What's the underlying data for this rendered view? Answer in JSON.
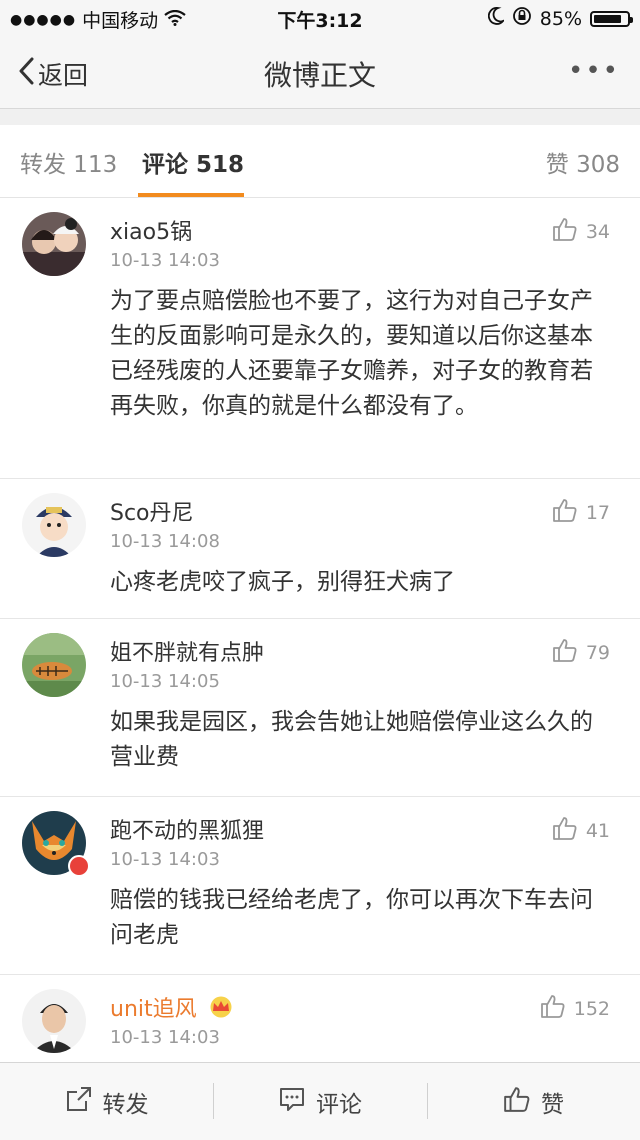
{
  "status_bar": {
    "signal_dots": "●●●●●",
    "carrier": "中国移动",
    "time": "下午3:12",
    "battery_pct": "85%",
    "battery_level": 0.85
  },
  "nav": {
    "back_label": "返回",
    "title": "微博正文",
    "more_label": "•••"
  },
  "tabs": {
    "repost": "转发 113",
    "comments": "评论 518",
    "likes": "赞 308"
  },
  "comments": [
    {
      "user": "xiao5锅",
      "time": "10-13 14:03",
      "likes": "34",
      "text": "为了要点赔偿脸也不要了，这行为对自己子女产生的反面影响可是永久的，要知道以后你这基本已经残废的人还要靠子女赡养，对子女的教育若再失败，你真的就是什么都没有了。"
    },
    {
      "user": "Sco丹尼",
      "time": "10-13 14:08",
      "likes": "17",
      "text": "心疼老虎咬了疯子，别得狂犬病了"
    },
    {
      "user": "姐不胖就有点肿",
      "time": "10-13 14:05",
      "likes": "79",
      "text": "如果我是园区，我会告她让她赔偿停业这么久的营业费"
    },
    {
      "user": "跑不动的黑狐狸",
      "time": "10-13 14:03",
      "likes": "41",
      "text": "赔偿的钱我已经给老虎了，你可以再次下车去问问老虎"
    },
    {
      "user": "unit追风",
      "time": "10-13 14:03",
      "likes": "152",
      "text": ""
    }
  ],
  "toolbar": {
    "repost": "转发",
    "comment": "评论",
    "like": "赞"
  },
  "colors": {
    "accent": "#f28b1e",
    "vip_name": "#eb7b2e",
    "text": "#333333",
    "muted": "#9a9a9a"
  },
  "icons": [
    "wifi-icon",
    "moon-icon",
    "rotation-lock-icon",
    "battery-icon",
    "back-chevron-icon",
    "more-icon",
    "thumbs-up-icon",
    "vip-badge-icon",
    "crown-icon",
    "share-icon",
    "comment-icon"
  ]
}
